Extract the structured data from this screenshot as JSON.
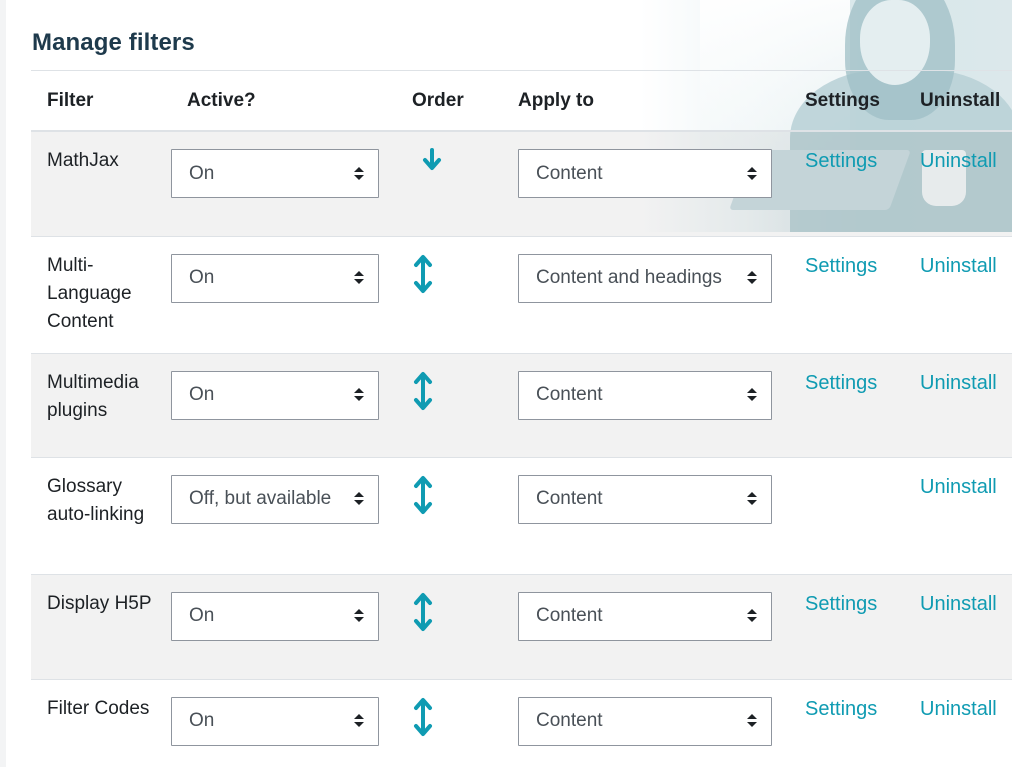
{
  "page": {
    "title": "Manage filters"
  },
  "table": {
    "headers": {
      "filter": "Filter",
      "active": "Active?",
      "order": "Order",
      "apply_to": "Apply to",
      "settings": "Settings",
      "uninstall": "Uninstall"
    },
    "rows": [
      {
        "name": "MathJax",
        "active": "On",
        "order": "down",
        "apply_to": "Content",
        "settings": "Settings",
        "uninstall": "Uninstall"
      },
      {
        "name": "Multi-Language Content",
        "active": "On",
        "order": "up-down",
        "apply_to": "Content and headings",
        "settings": "Settings",
        "uninstall": "Uninstall"
      },
      {
        "name": "Multimedia plugins",
        "active": "On",
        "order": "up-down",
        "apply_to": "Content",
        "settings": "Settings",
        "uninstall": "Uninstall"
      },
      {
        "name": "Glossary auto-linking",
        "active": "Off, but available",
        "order": "up-down",
        "apply_to": "Content",
        "settings": "",
        "uninstall": "Uninstall"
      },
      {
        "name": "Display H5P",
        "active": "On",
        "order": "up-down",
        "apply_to": "Content",
        "settings": "Settings",
        "uninstall": "Uninstall"
      },
      {
        "name": "Filter Codes",
        "active": "On",
        "order": "up-down",
        "apply_to": "Content",
        "settings": "Settings",
        "uninstall": "Uninstall"
      }
    ]
  },
  "icons": {
    "move_down": "arrow-down-icon",
    "move_up_down": "arrow-up-down-icon",
    "select_caret": "caret-up-down-icon"
  },
  "colors": {
    "link": "#0f9bb2",
    "title": "#1e3a4c",
    "stripe": "#f2f2f2",
    "border": "#dee2e6"
  }
}
